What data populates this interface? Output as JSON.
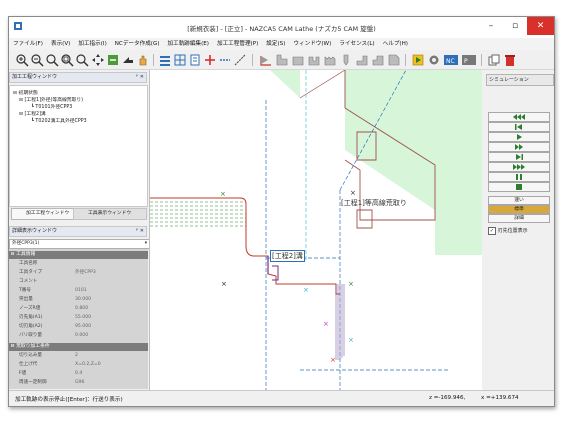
{
  "window": {
    "title": "[新規衣装] - [正立] - NAZCA5 CAM Lathe (ナズカ5 CAM 旋盤)"
  },
  "menu": [
    "ファイル(F)",
    "表示(V)",
    "加工指示(I)",
    "NCデータ作成(G)",
    "加工軌跡編集(E)",
    "加工工程管理(P)",
    "設定(S)",
    "ウィンドウ(W)",
    "ライセンス(L)",
    "ヘルプ(H)"
  ],
  "process_panel": {
    "title": "加工工程ウィンドウ",
    "items": [
      "初期状態",
      "[工程1]外径(等高線荒取り)",
      "T0101外径CPP3",
      "[工程2]溝",
      "T0202溝工具外径CPP3"
    ]
  },
  "tabs": {
    "process": "加工工程ウィンドウ",
    "tool": "工具表示ウィンドウ"
  },
  "detail_panel": {
    "title": "詳細表示ウィンドウ",
    "selector": "外径CPP3(1)"
  },
  "tool_info": {
    "title": "工具情報",
    "rows": [
      {
        "k": "工具名称",
        "v": ""
      },
      {
        "k": "工具タイプ",
        "v": "外径CPP3"
      },
      {
        "k": "コメント",
        "v": ""
      },
      {
        "k": "T番号",
        "v": "0101"
      },
      {
        "k": "突出量",
        "v": "30.000"
      },
      {
        "k": "ノーズR値",
        "v": "0.800"
      },
      {
        "k": "刃先角(A1)",
        "v": "55.000"
      },
      {
        "k": "切刃角(A2)",
        "v": "95.000"
      },
      {
        "k": "バリ取り量",
        "v": "0.000"
      }
    ]
  },
  "cut_info": {
    "title": "荒取り加工条件",
    "rows": [
      {
        "k": "切り込み量",
        "v": "2"
      },
      {
        "k": "仕上げ代",
        "v": "X=0.2,Z=0"
      },
      {
        "k": "F値",
        "v": "0.4"
      },
      {
        "k": "周速一定制御",
        "v": "G96"
      }
    ]
  },
  "canvas": {
    "label1": "[工程1]等高線荒取り",
    "label2": "[工程2]溝"
  },
  "simulation": {
    "title": "シミュレーション",
    "speeds": [
      "速い",
      "標準",
      "詳細"
    ],
    "checkbox": "刃先位置表示"
  },
  "status": {
    "message": "加工軌跡の表示停止([Enter]：行送り表示)",
    "z": "z =-169.946,",
    "x": "x =+139.674"
  },
  "colors": {
    "accent": "#2e7d32",
    "close_button": "#e81123",
    "stock": "#d6f5d9"
  }
}
